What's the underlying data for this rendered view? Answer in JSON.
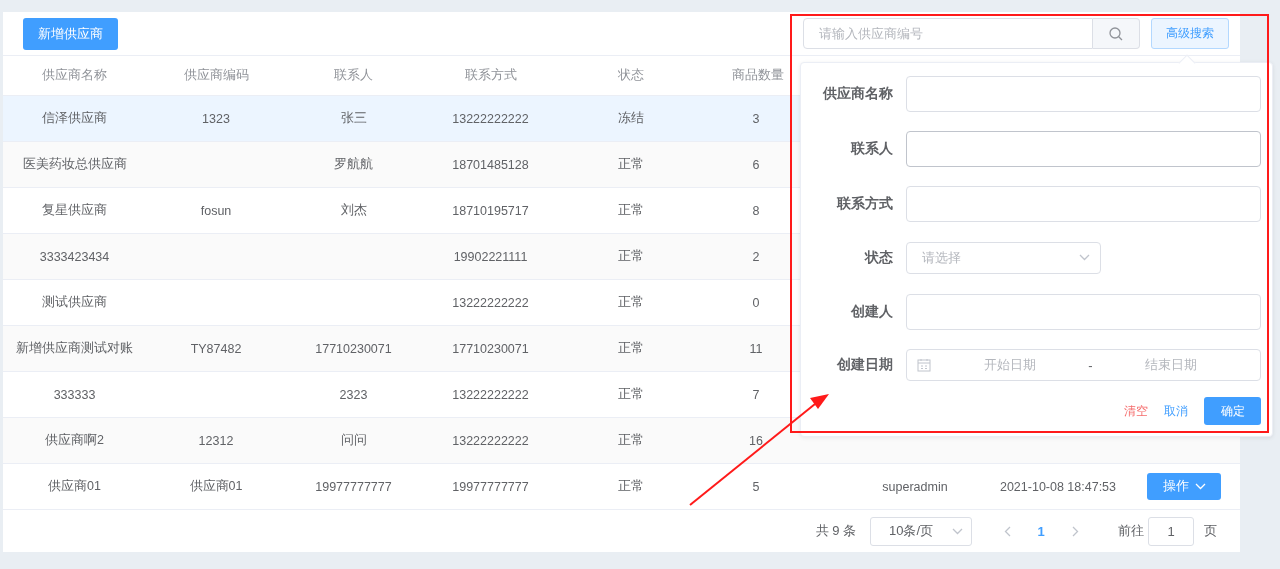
{
  "toolbar": {
    "add_button": "新增供应商",
    "search": {
      "placeholder": "请输入供应商编号"
    },
    "advanced_button": "高级搜索"
  },
  "table": {
    "columns": [
      "供应商名称",
      "供应商编码",
      "联系人",
      "联系方式",
      "状态",
      "商品数量"
    ],
    "rows": [
      {
        "selected": true,
        "name": "信泽供应商",
        "code": "1323",
        "contact": "张三",
        "phone": "13222222222",
        "status": "冻结",
        "count": "3"
      },
      {
        "selected": false,
        "name": "医美药妆总供应商",
        "contact": "罗航航",
        "phone": "18701485128",
        "status": "正常",
        "count": "6"
      },
      {
        "selected": false,
        "name": "复星供应商",
        "code": "fosun",
        "contact": "刘杰",
        "phone": "18710195717",
        "status": "正常",
        "count": "8"
      },
      {
        "selected": false,
        "name": "3333423434",
        "phone": "19902221111",
        "status": "正常",
        "count": "2"
      },
      {
        "selected": false,
        "name": "测试供应商",
        "phone": "13222222222",
        "status": "正常",
        "count": "0"
      },
      {
        "selected": false,
        "name": "新增供应商测试对账",
        "code": "TY87482",
        "contact": "17710230071",
        "phone": "17710230071",
        "status": "正常",
        "count": "11"
      },
      {
        "selected": false,
        "name": "333333",
        "contact": "2323",
        "phone": "13222222222",
        "status": "正常",
        "count": "7"
      },
      {
        "selected": false,
        "name": "供应商啊2",
        "code": "12312",
        "contact": "问问",
        "phone": "13222222222",
        "status": "正常",
        "count": "16"
      },
      {
        "selected": false,
        "name": "供应商01",
        "code": "供应商01",
        "contact": "19977777777",
        "phone": "19977777777",
        "status": "正常",
        "count": "5",
        "creator": "superadmin",
        "created_at": "2021-10-08 18:47:53",
        "action": "操作"
      }
    ]
  },
  "pagination": {
    "total": "共 9 条",
    "page_size": "10条/页",
    "pages": [
      {
        "label": "1",
        "selected": true
      }
    ],
    "goto_label": "前往",
    "goto_value": "1",
    "goto_suffix": "页"
  },
  "advanced_search": {
    "fields": [
      {
        "kind": "text",
        "label": "供应商名称",
        "focused": false
      },
      {
        "kind": "text",
        "label": "联系人",
        "focused": true
      },
      {
        "kind": "text",
        "label": "联系方式",
        "focused": false
      },
      {
        "kind": "select",
        "label": "状态",
        "placeholder": "请选择",
        "focused": false
      },
      {
        "kind": "text",
        "label": "创建人",
        "focused": false
      },
      {
        "kind": "daterange",
        "label": "创建日期",
        "start_placeholder": "开始日期",
        "separator": "-",
        "end_placeholder": "结束日期",
        "focused": false
      }
    ],
    "clear_button": "清空",
    "cancel_button": "取消",
    "confirm_button": "确定"
  }
}
